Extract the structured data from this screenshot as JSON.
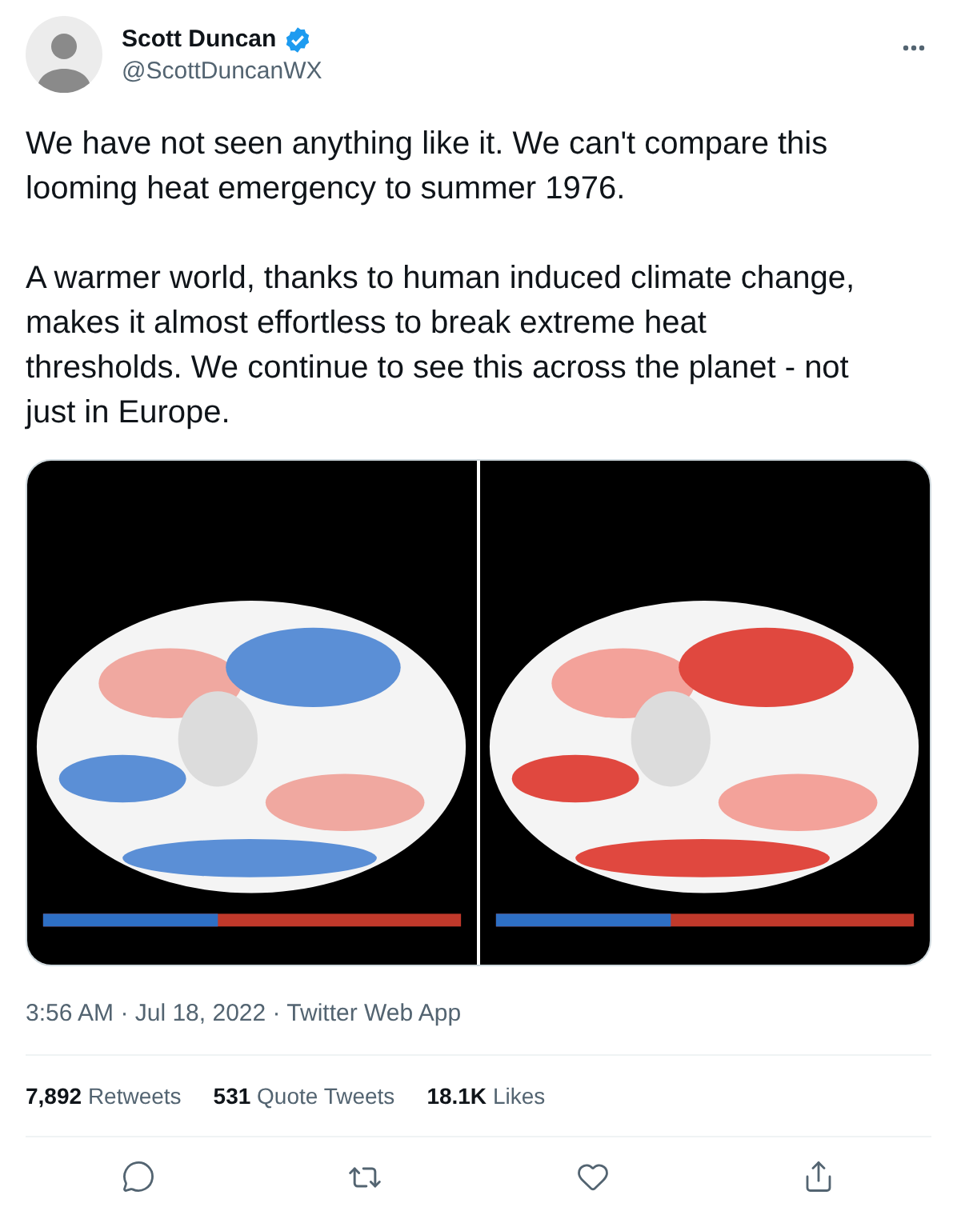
{
  "author": {
    "name": "Scott Duncan",
    "verified": true,
    "handle": "@ScottDuncanWX"
  },
  "paragraphs": [
    "We have not seen anything like it. We can't compare this looming heat emergency to summer 1976.",
    "A warmer world, thanks to human induced climate change, makes it almost effortless to break extreme heat thresholds. We continue to see this across the planet - not just in Europe."
  ],
  "media": [
    {
      "kind": "picture"
    },
    {
      "kind": "picture"
    }
  ],
  "meta": "3:56 AM · Jul 18, 2022 · Twitter Web App",
  "stats": [
    {
      "count": "7,892",
      "label": "Retweets"
    },
    {
      "count": "531",
      "label": "Quote Tweets"
    },
    {
      "count": "18.1K",
      "label": "Likes"
    }
  ]
}
